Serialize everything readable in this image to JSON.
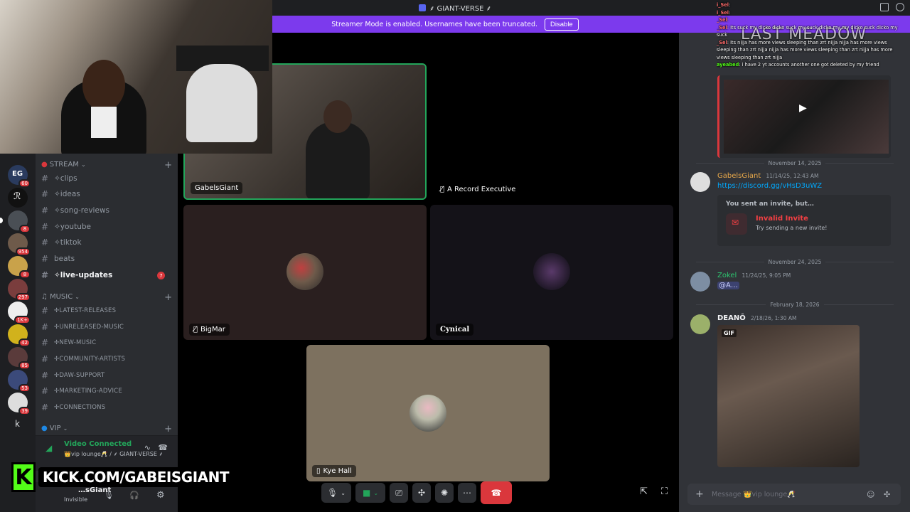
{
  "window": {
    "title": "⸙ GIANT-VERSE ⸙"
  },
  "banner": {
    "text": "Streamer Mode is enabled. Usernames have been truncated.",
    "disable_label": "Disable"
  },
  "servers": [
    {
      "label": "EG",
      "badge": "60"
    },
    {
      "label": "ℛ",
      "badge": ""
    },
    {
      "label": "",
      "badge": "8"
    },
    {
      "label": "",
      "badge": "954"
    },
    {
      "label": "",
      "badge": "8"
    },
    {
      "label": "",
      "badge": "297"
    },
    {
      "label": "",
      "badge": "1K+"
    },
    {
      "label": "",
      "badge": "42"
    },
    {
      "label": "",
      "badge": "85"
    },
    {
      "label": "",
      "badge": "53"
    },
    {
      "label": "",
      "badge": "39"
    },
    {
      "label": "k",
      "badge": ""
    }
  ],
  "sidebar": {
    "categories": {
      "stream": "STREAM",
      "music": "MUSIC",
      "vip": "VIP"
    },
    "stream_channels": [
      "✧clips",
      "✧ideas",
      "✧song-reviews",
      "✧youtube",
      "✧tiktok",
      "beats",
      "✧live-updates"
    ],
    "live_updates_mentions": "7",
    "music_channels": [
      "✢LATEST-RELEASES",
      "✢UNRELEASED-MUSIC",
      "✢NEW-MUSIC",
      "✢COMMUNITY-ARTISTS",
      "✢DAW-SUPPORT",
      "✢MARKETING-ADVICE",
      "✢CONNECTIONS"
    ]
  },
  "voice": {
    "status": "Video Connected",
    "location": "👑vip lounge🥂 / ⸙ GIANT-VERSE ⸙"
  },
  "user": {
    "name": "…sGiant",
    "status": "Invisible"
  },
  "stage": {
    "tiles": [
      {
        "name": "GabelsGiant"
      },
      {
        "name": "A Record Executive"
      },
      {
        "name": "BigMar"
      },
      {
        "name": "Cynical"
      },
      {
        "name": "Kye Hall"
      }
    ]
  },
  "chat": {
    "dates": [
      "November 14, 2025",
      "November 24, 2025",
      "February 18, 2026"
    ],
    "messages": [
      {
        "author": "GabelsGiant",
        "timestamp": "11/14/25, 12:43 AM",
        "text": "https://discord.gg/vHsD3uWZ",
        "author_color": "#e8a84a"
      },
      {
        "author": "Zokel",
        "timestamp": "11/24/25, 9:05 PM",
        "text": "@A…",
        "author_color": "#2dc770"
      },
      {
        "author": "DEANŌ",
        "timestamp": "2/18/26, 1:30 AM",
        "text": "",
        "author_color": "#f2f3f5"
      }
    ],
    "invite": {
      "heading": "You sent an invite, but…",
      "title": "Invalid Invite",
      "sub": "Try sending a new invite!"
    },
    "gif_label": "GIF",
    "input_placeholder": "Message 👑vip lounge🥂"
  },
  "overlay": {
    "kick_chat": [
      {
        "user": "i_Sel",
        "text": ":"
      },
      {
        "user": "i_Sel",
        "text": ":"
      },
      {
        "user": "_Sel",
        "text": ":"
      },
      {
        "user": "_Sel",
        "text": ": Its suck my dicko dicko suck my suck dicko my my dicko suck dicko my suck"
      },
      {
        "user": "_Sel",
        "text": ": Its nijja has more views sleeping than zrt nijja nijja has more views sleeping than zrt nijja nijja has more views sleeping than zrt nijja has more views sleeping than zrt nijja"
      },
      {
        "user": "ayeabed",
        "text": ": i have 2 yt accounts another one got deleted by my friend"
      }
    ],
    "embed_title": "LAST MEADOW",
    "kick_url": "KICK.COM/GABEISGIANT"
  }
}
